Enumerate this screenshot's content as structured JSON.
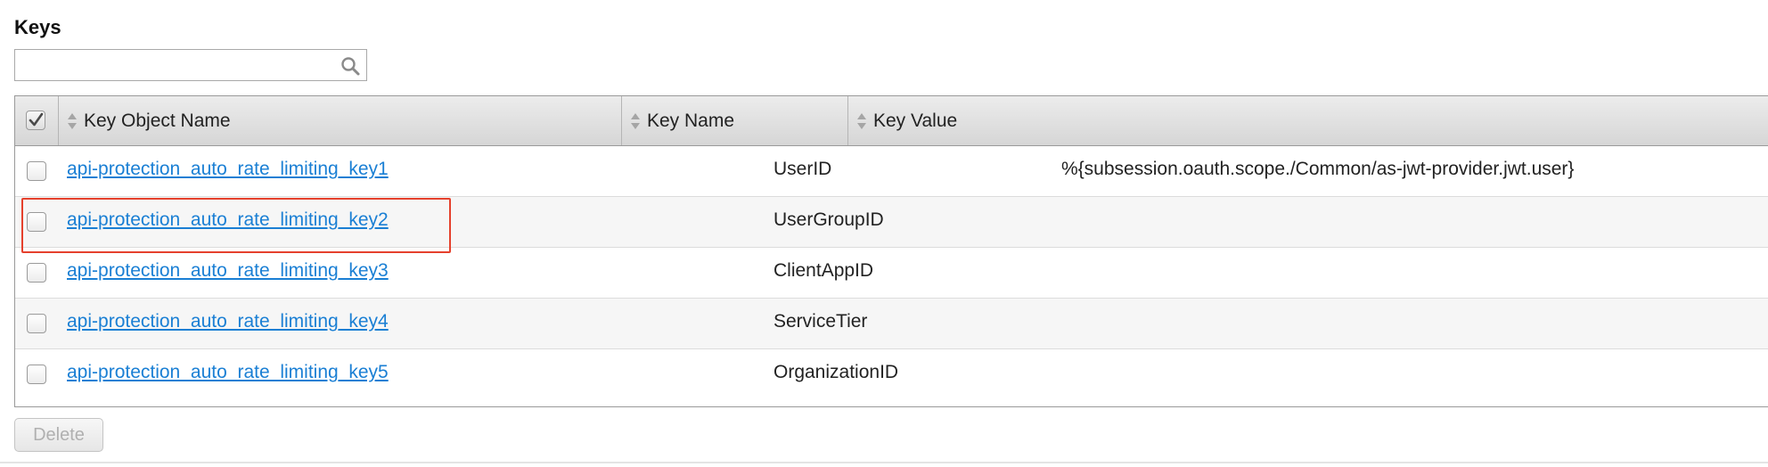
{
  "section": {
    "title": "Keys"
  },
  "search": {
    "value": "",
    "placeholder": ""
  },
  "table": {
    "columns": [
      {
        "label": "Key Object Name"
      },
      {
        "label": "Key Name"
      },
      {
        "label": "Key Value"
      }
    ],
    "header_checkbox_checked": true,
    "rows": [
      {
        "object_name": "api-protection_auto_rate_limiting_key1",
        "key_name": "UserID",
        "key_value": "%{subsession.oauth.scope./Common/as-jwt-provider.jwt.user}",
        "checked": false
      },
      {
        "object_name": "api-protection_auto_rate_limiting_key2",
        "key_name": "UserGroupID",
        "key_value": "",
        "checked": false
      },
      {
        "object_name": "api-protection_auto_rate_limiting_key3",
        "key_name": "ClientAppID",
        "key_value": "",
        "checked": false
      },
      {
        "object_name": "api-protection_auto_rate_limiting_key4",
        "key_name": "ServiceTier",
        "key_value": "",
        "checked": false
      },
      {
        "object_name": "api-protection_auto_rate_limiting_key5",
        "key_name": "OrganizationID",
        "key_value": "",
        "checked": false
      }
    ]
  },
  "actions": {
    "delete_label": "Delete",
    "delete_enabled": false
  },
  "colors": {
    "link": "#1a7fd4",
    "highlight": "#e5412d",
    "header_bg": "#dcdcdc",
    "alt_row": "#f6f6f6"
  },
  "icons": {
    "search": "search-icon",
    "sort": "sort-icon",
    "check": "checkmark-icon"
  }
}
